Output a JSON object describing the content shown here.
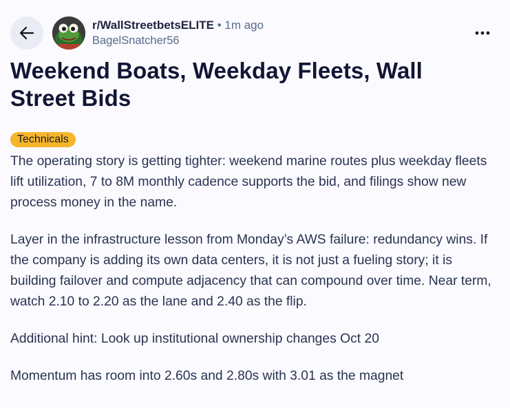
{
  "post": {
    "subreddit": "r/WallStreetbetsELITE",
    "separator": "•",
    "time_ago": "1m ago",
    "author": "BagelSnatcher56",
    "title": "Weekend Boats, Weekday Fleets, Wall Street Bids",
    "flair": "Technicals",
    "paragraphs": [
      "The operating story is getting tighter: weekend marine routes plus weekday fleets lift utilization, 7 to 8M monthly cadence supports the bid, and filings show new process money in the name.",
      "Layer in the infrastructure lesson from Monday’s AWS failure: redundancy wins. If the company is adding its own data centers, it is not just a fueling story; it is building failover and compute adjacency that can compound over time. Near term, watch 2.10 to 2.20 as the lane and 2.40 as the flip.",
      "Additional hint: Look up institutional ownership changes Oct 20",
      "Momentum has room into 2.60s and 2.80s with 3.01 as the magnet"
    ]
  },
  "icons": {
    "back": "back-arrow-icon",
    "more": "more-options-icon",
    "avatar": "frog-avatar"
  },
  "colors": {
    "background": "#fafaff",
    "flair": "#f7b52c",
    "title": "#121635",
    "meta": "#5a6b8c"
  }
}
